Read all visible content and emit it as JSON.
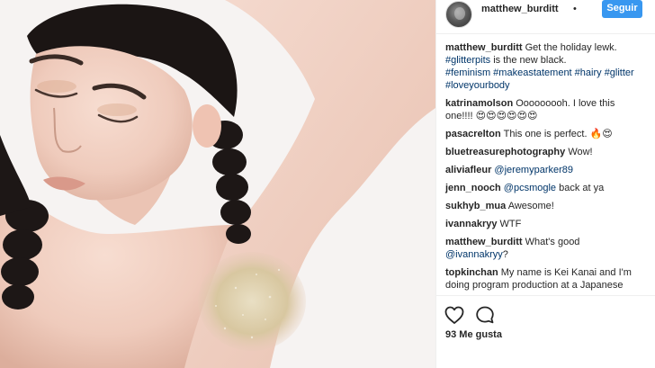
{
  "post": {
    "author": "matthew_burditt",
    "follow_label": "Seguir",
    "likes_label": "93 Me gusta"
  },
  "caption": {
    "user": "matthew_burditt",
    "text": "Get the holiday lewk.",
    "tag1": "#glitterpits",
    "text2": "is the new black.",
    "tags": "#feminism #makeastatement #hairy #glitter #loveyourbody"
  },
  "comments": [
    {
      "user": "katrinamolson",
      "text": "Ooooooooh. I love this one!!!! 😍😍😍😍😍😍"
    },
    {
      "user": "pasacrelton",
      "text": "This one is perfect. 🔥😍"
    },
    {
      "user": "bluetreasurephotography",
      "text": "Wow!"
    },
    {
      "user": "aliviafleur",
      "mention": "@jeremyparker89",
      "text": ""
    },
    {
      "user": "jenn_nooch",
      "mention": "@pcsmogle",
      "text": "back at ya"
    },
    {
      "user": "sukhyb_mua",
      "text": "Awesome!"
    },
    {
      "user": "ivannakryy",
      "text": "WTF"
    },
    {
      "user": "matthew_burditt",
      "text": "What's good",
      "mention": "@ivannakryy",
      "after": "?"
    },
    {
      "user": "topkinchan",
      "text": "My name is Kei Kanai and I'm doing program production at a Japanese television station."
    }
  ],
  "icons": {
    "like": "heart-icon",
    "comment": "comment-icon"
  },
  "colors": {
    "follow_button": "#3897f0",
    "link": "#003569",
    "text": "#262626"
  }
}
